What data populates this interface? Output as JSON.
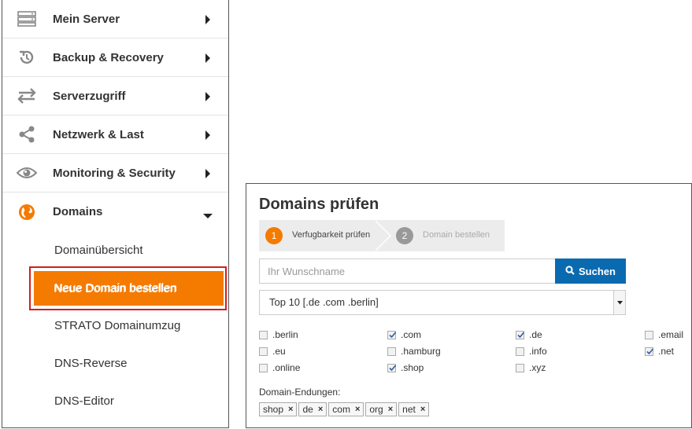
{
  "sidebar": {
    "items": [
      {
        "label": "Mein Server",
        "icon": "server-icon"
      },
      {
        "label": "Backup & Recovery",
        "icon": "backup-icon"
      },
      {
        "label": "Serverzugriff",
        "icon": "transfer-icon"
      },
      {
        "label": "Netzwerk & Last",
        "icon": "share-icon"
      },
      {
        "label": "Monitoring & Security",
        "icon": "eye-icon"
      },
      {
        "label": "Domains",
        "icon": "globe-icon"
      }
    ],
    "subitems": [
      {
        "label": "Domainübersicht"
      },
      {
        "label": "Neue Domain bestellen",
        "active": true
      },
      {
        "label": "STRATO Domainumzug"
      },
      {
        "label": "DNS-Reverse"
      },
      {
        "label": "DNS-Editor"
      }
    ],
    "accent_color": "#f47b00",
    "highlight_color": "#d51c1c"
  },
  "panel": {
    "title": "Domains prüfen",
    "steps": [
      {
        "number": "1",
        "label": "Verfugbarkeit prüfen",
        "active": true
      },
      {
        "number": "2",
        "label": "Domain bestellen",
        "active": false
      }
    ],
    "search": {
      "placeholder": "Ihr Wunschname",
      "button_label": "Suchen"
    },
    "select": {
      "value": "Top 10 [.de .com .berlin]"
    },
    "tlds": [
      {
        "label": ".berlin",
        "checked": false
      },
      {
        "label": ".com",
        "checked": true
      },
      {
        "label": ".de",
        "checked": true
      },
      {
        "label": ".email",
        "checked": false
      },
      {
        "label": ".eu",
        "checked": false
      },
      {
        "label": ".hamburg",
        "checked": false
      },
      {
        "label": ".info",
        "checked": false
      },
      {
        "label": ".net",
        "checked": true
      },
      {
        "label": ".online",
        "checked": false
      },
      {
        "label": ".shop",
        "checked": true
      },
      {
        "label": ".xyz",
        "checked": false
      }
    ],
    "endings_label": "Domain-Endungen:",
    "tags": [
      "shop",
      "de",
      "com",
      "org",
      "net"
    ],
    "tag_remove": "×",
    "button_color": "#0a6ab0"
  }
}
